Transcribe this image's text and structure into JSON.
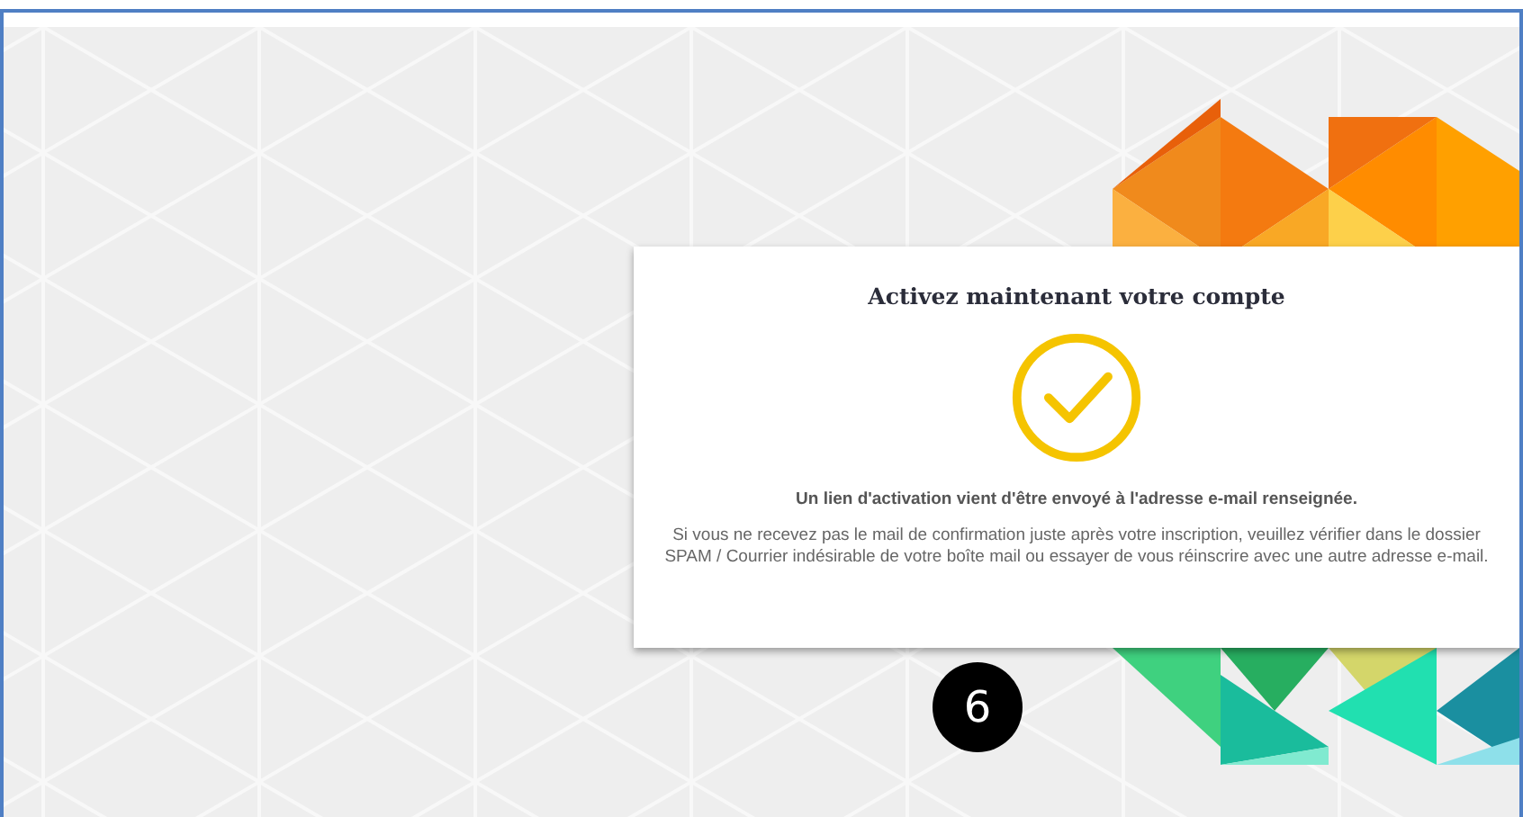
{
  "dialog": {
    "title": "Activez maintenant votre compte",
    "message": "Un lien d'activation vient d'être envoyé à l'adresse e-mail renseignée.",
    "note": "Si vous ne recevez pas le mail de confirmation juste après votre inscription, veuillez vérifier dans le dossier SPAM / Courrier indésirable de votre boîte mail ou essayer de vous réinscrire avec une autre adresse e-mail."
  },
  "step_badge": "6"
}
